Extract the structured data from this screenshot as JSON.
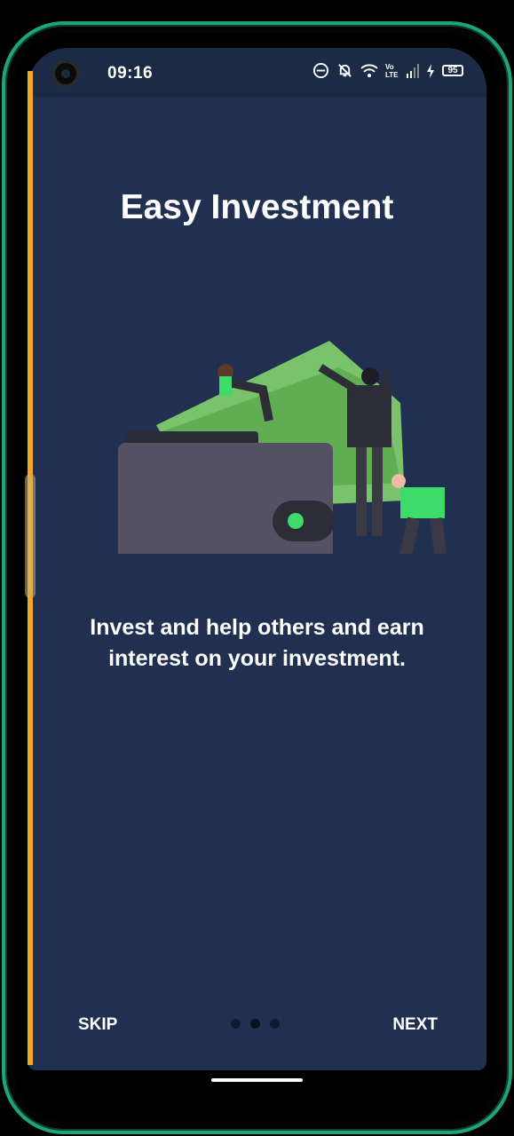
{
  "status_bar": {
    "time": "09:16",
    "battery": "95",
    "network": "Vo LTE",
    "icons": [
      "do-not-disturb-icon",
      "bell-off-icon",
      "wifi-icon",
      "signal-icon",
      "charging-icon",
      "battery-icon"
    ]
  },
  "onboarding": {
    "title": "Easy Investment",
    "description": "Invest and help others and earn interest on your investment.",
    "page_count": 3,
    "current_page": 2
  },
  "footer": {
    "skip_label": "SKIP",
    "next_label": "NEXT"
  },
  "colors": {
    "background": "#213050",
    "accent_green": "#3ddc6a",
    "money_green": "#7ac36a",
    "wallet": "#545262",
    "frame": "#1fa37a",
    "edge": "#f5a623"
  }
}
